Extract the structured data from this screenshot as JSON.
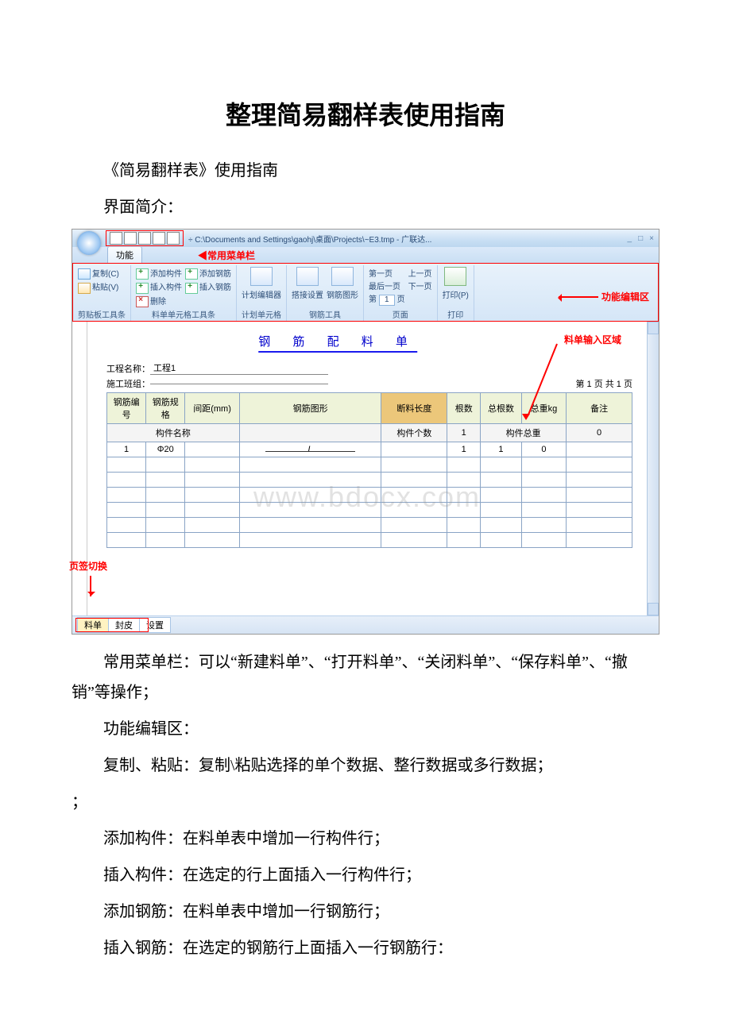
{
  "doc": {
    "title": "整理简易翻样表使用指南",
    "p1": "《简易翻样表》使用指南",
    "p2": "界面简介：",
    "p3a": "常用菜单栏：可以“新建料单”、“打开料单”、“关闭料单”、“保存料单”、“撤销”等操作；",
    "p4": "功能编辑区：",
    "p5": "复制、粘贴：复制\\粘贴选择的单个数据、整行数据或多行数据；",
    "p6": "添加构件：在料单表中增加一行构件行；",
    "p7": "插入构件：在选定的行上面插入一行构件行；",
    "p8": "添加钢筋：在料单表中增加一行钢筋行；",
    "p9": "插入钢筋：在选定的钢筋行上面插入一行钢筋行："
  },
  "shot": {
    "path": "÷ C:\\Documents and Settings\\gaohj\\桌面\\Projects\\~E3.tmp - 广联达...",
    "winbtns": [
      "_",
      "□",
      "×"
    ],
    "menuTab": "功能",
    "ann": {
      "qat": "常用菜单栏",
      "func": "功能编辑区",
      "input": "料单输入区域",
      "tab": "页签切换"
    },
    "ribbon": {
      "g1": {
        "copy": "复制(C)",
        "paste": "粘贴(V)",
        "label": "剪贴板工具条"
      },
      "g2": {
        "a": "添加构件",
        "b": "插入构件",
        "c": "删除",
        "d": "添加钢筋",
        "e": "插入钢筋",
        "label": "料单单元格工具条"
      },
      "g3": {
        "a": "计划编辑器",
        "label": "计划单元格"
      },
      "g4": {
        "a": "搭接设置",
        "b": "钢筋图形",
        "label": "钢筋工具"
      },
      "g5": {
        "a": "第一页",
        "b": "最后一页",
        "c": "第",
        "d": "页",
        "e": "上一页",
        "f": "下一页",
        "pg": "1",
        "label": "页面"
      },
      "g6": {
        "a": "打印(P)",
        "label": "打印"
      }
    },
    "sheet": {
      "title": "钢 筋 配 料 单",
      "projLabel": "工程名称：",
      "projVal": "工程1",
      "teamLabel": "施工班组：",
      "pageInfo": "第 1 页 共 1 页",
      "headers": [
        "钢筋编号",
        "钢筋规格",
        "间距(mm)",
        "钢筋图形",
        "断料长度",
        "根数",
        "总根数",
        "总重kg",
        "备注"
      ],
      "compRow": {
        "name": "构件名称",
        "cnt": "构件个数",
        "cntv": "1",
        "wt": "构件总重",
        "wtv": "0"
      },
      "row1": {
        "no": "1",
        "spec": "Φ20",
        "shape": "L",
        "n1": "1",
        "n2": "1",
        "w": "0"
      }
    },
    "tabs": [
      "料单",
      "封皮",
      "设置"
    ],
    "watermark": "www.bdocx.com"
  }
}
